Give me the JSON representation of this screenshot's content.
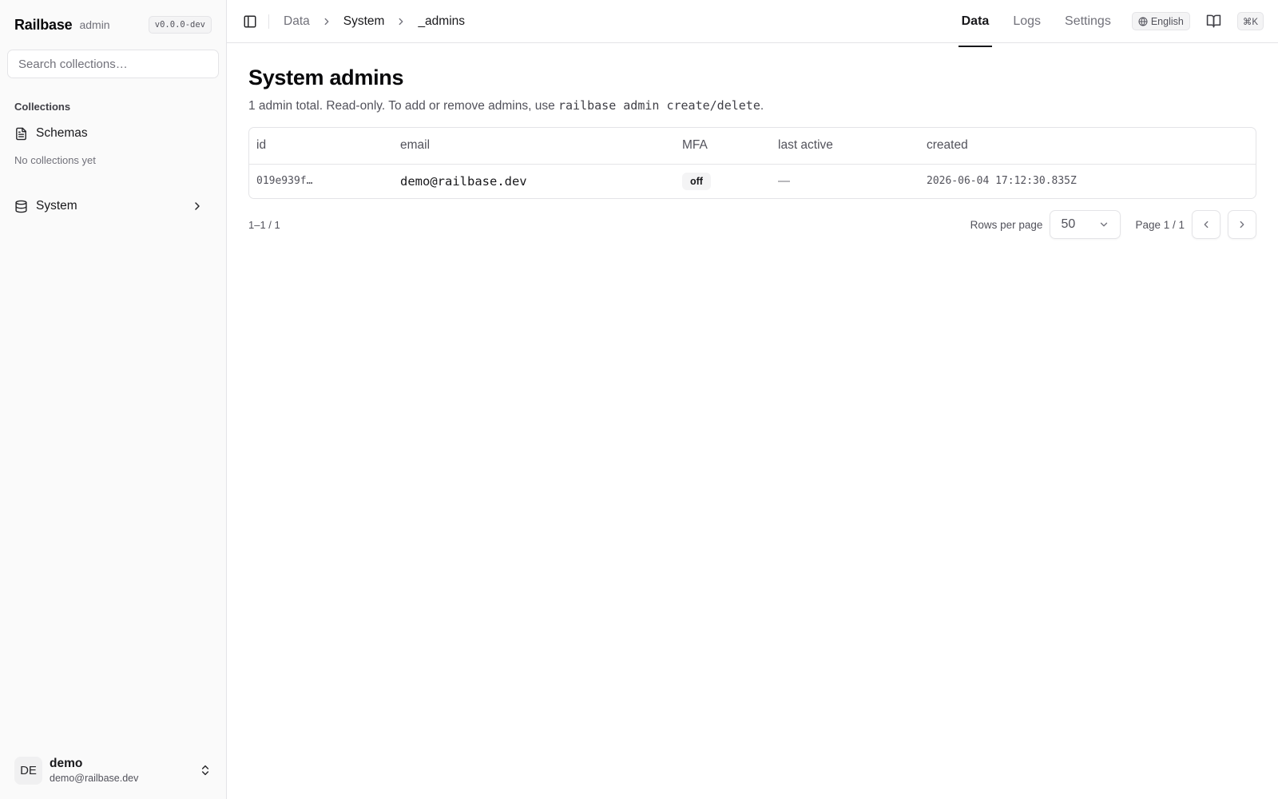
{
  "sidebar": {
    "brand": "Railbase",
    "brand_sub": "admin",
    "version": "v0.0.0-dev",
    "search_placeholder": "Search collections…",
    "section_label": "Collections",
    "schemas_label": "Schemas",
    "empty_text": "No collections yet",
    "system_label": "System",
    "user": {
      "initials": "DE",
      "name": "demo",
      "email": "demo@railbase.dev"
    }
  },
  "topbar": {
    "breadcrumbs": [
      "Data",
      "System",
      "_admins"
    ],
    "tabs": [
      {
        "label": "Data",
        "active": true
      },
      {
        "label": "Logs",
        "active": false
      },
      {
        "label": "Settings",
        "active": false
      }
    ],
    "language": "English",
    "shortcut": "⌘K"
  },
  "page": {
    "title": "System admins",
    "subtitle_prefix": "1 admin total. Read-only. To add or remove admins, use ",
    "subtitle_code": "railbase admin create/delete",
    "subtitle_suffix": "."
  },
  "table": {
    "columns": [
      "id",
      "email",
      "MFA",
      "last active",
      "created"
    ],
    "rows": [
      {
        "id": "019e939f…",
        "email": "demo@railbase.dev",
        "mfa": "off",
        "last_active": "—",
        "created": "2026-06-04 17:12:30.835Z"
      }
    ]
  },
  "pagination": {
    "range": "1–1 / 1",
    "rows_per_page_label": "Rows per page",
    "rows_per_page_value": "50",
    "page_label": "Page 1 / 1"
  },
  "icons": {
    "sidebar_toggle": "sidebar-toggle-icon",
    "schemas": "file-text-icon",
    "system": "database-icon",
    "globe": "globe-icon",
    "docs": "book-open-icon"
  }
}
